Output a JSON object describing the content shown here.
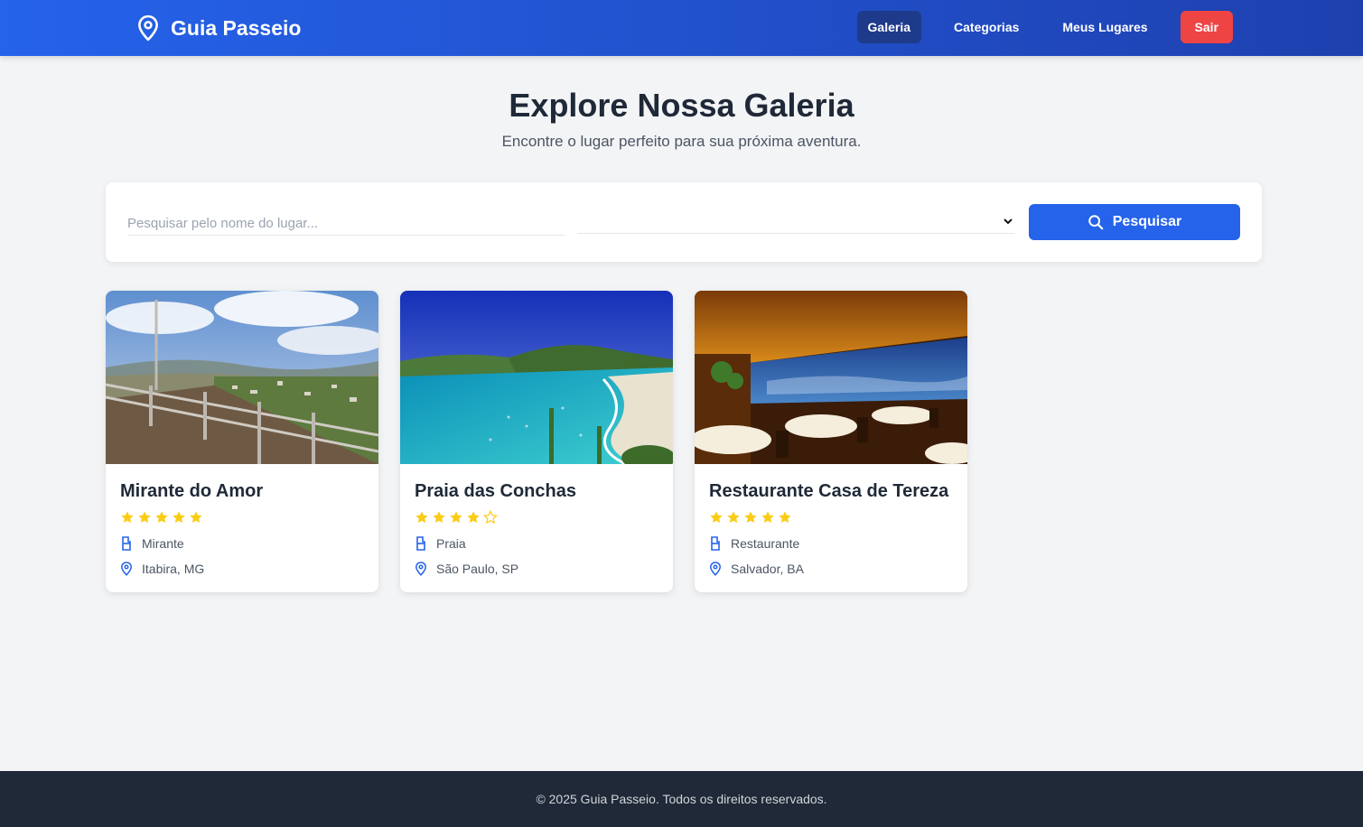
{
  "header": {
    "brand": "Guia Passeio",
    "nav": [
      {
        "label": "Galeria",
        "active": true
      },
      {
        "label": "Categorias",
        "active": false
      },
      {
        "label": "Meus Lugares",
        "active": false
      }
    ],
    "logout_label": "Sair"
  },
  "hero": {
    "title": "Explore Nossa Galeria",
    "subtitle": "Encontre o lugar perfeito para sua próxima aventura."
  },
  "search": {
    "placeholder": "Pesquisar pelo nome do lugar...",
    "value": "",
    "category_selected": "",
    "button_label": "Pesquisar"
  },
  "places": [
    {
      "name": "Mirante do Amor",
      "rating": 5,
      "max_rating": 5,
      "category": "Mirante",
      "location": "Itabira, MG",
      "image": "overlook-landscape"
    },
    {
      "name": "Praia das Conchas",
      "rating": 4,
      "max_rating": 5,
      "category": "Praia",
      "location": "São Paulo, SP",
      "image": "beach-bay"
    },
    {
      "name": "Restaurante Casa de Tereza",
      "rating": 5,
      "max_rating": 5,
      "category": "Restaurante",
      "location": "Salvador, BA",
      "image": "restaurant-interior"
    }
  ],
  "footer": {
    "text": "© 2025 Guia Passeio. Todos os direitos reservados."
  },
  "colors": {
    "primary": "#2563eb",
    "primary_dark": "#1e40af",
    "danger": "#ef4444",
    "star": "#facc15",
    "footer_bg": "#1f2937"
  },
  "icons": {
    "brand": "map-pin-icon",
    "search": "search-icon",
    "category": "tag-icon",
    "location": "map-pin-icon",
    "rating": "star-icon"
  }
}
